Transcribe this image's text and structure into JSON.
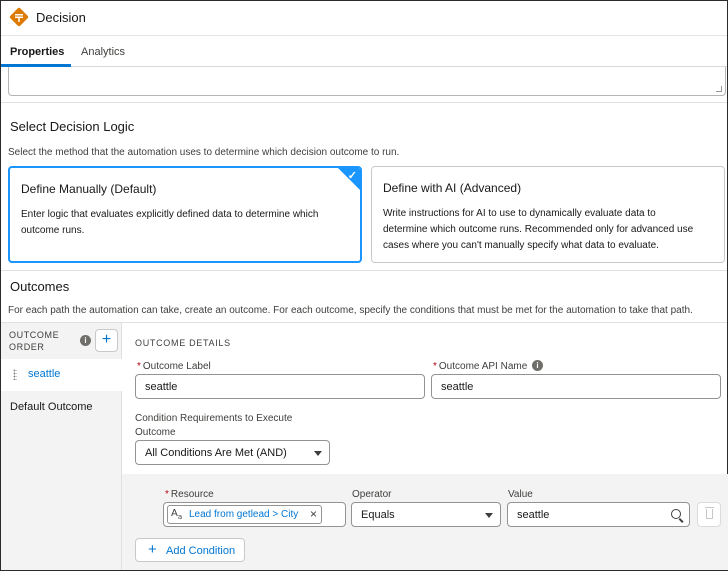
{
  "header": {
    "title": "Decision",
    "icon": "decision-icon",
    "icon_color": "#dd7a01"
  },
  "tabs": [
    {
      "label": "Properties",
      "active": true
    },
    {
      "label": "Analytics",
      "active": false
    }
  ],
  "logic": {
    "heading": "Select Decision Logic",
    "help": "Select the method that the automation uses to determine which decision outcome to run.",
    "options": [
      {
        "title": "Define Manually (Default)",
        "body_lines": [
          "Enter logic that evaluates explicitly defined data to determine which",
          "outcome runs."
        ],
        "selected": true
      },
      {
        "title": "Define with AI (Advanced)",
        "body_lines": [
          "Write instructions for AI to use to dynamically evaluate data to",
          "determine which outcome runs. Recommended only for advanced use",
          "cases where you can't manually specify what data to evaluate."
        ],
        "selected": false
      }
    ]
  },
  "outcomes": {
    "heading": "Outcomes",
    "help": "For each path the automation can take, create an outcome. For each outcome, specify the conditions that must be met for the automation to take that path.",
    "order_label_line1": "OUTCOME",
    "order_label_line2": "ORDER",
    "items": [
      {
        "label": "seattle",
        "active": true
      },
      {
        "label": "Default Outcome",
        "active": false
      }
    ]
  },
  "details": {
    "heading": "OUTCOME DETAILS",
    "label_field": {
      "label": "Outcome Label",
      "value": "seattle",
      "required": true
    },
    "api_field": {
      "label": "Outcome API Name",
      "value": "seattle",
      "required": true
    },
    "conditions_label_line1": "Condition Requirements to Execute",
    "conditions_label_line2": "Outcome",
    "conditions_value": "All Conditions Are Met (AND)"
  },
  "condition": {
    "resource_label": "Resource",
    "resource_value": "Lead from getlead > City",
    "operator_label": "Operator",
    "operator_value": "Equals",
    "value_label": "Value",
    "value_value": "seattle",
    "add_label": "Add Condition"
  },
  "colors": {
    "accent": "#0176d3",
    "selected_border": "#1b96ff",
    "required": "#ba0517"
  }
}
